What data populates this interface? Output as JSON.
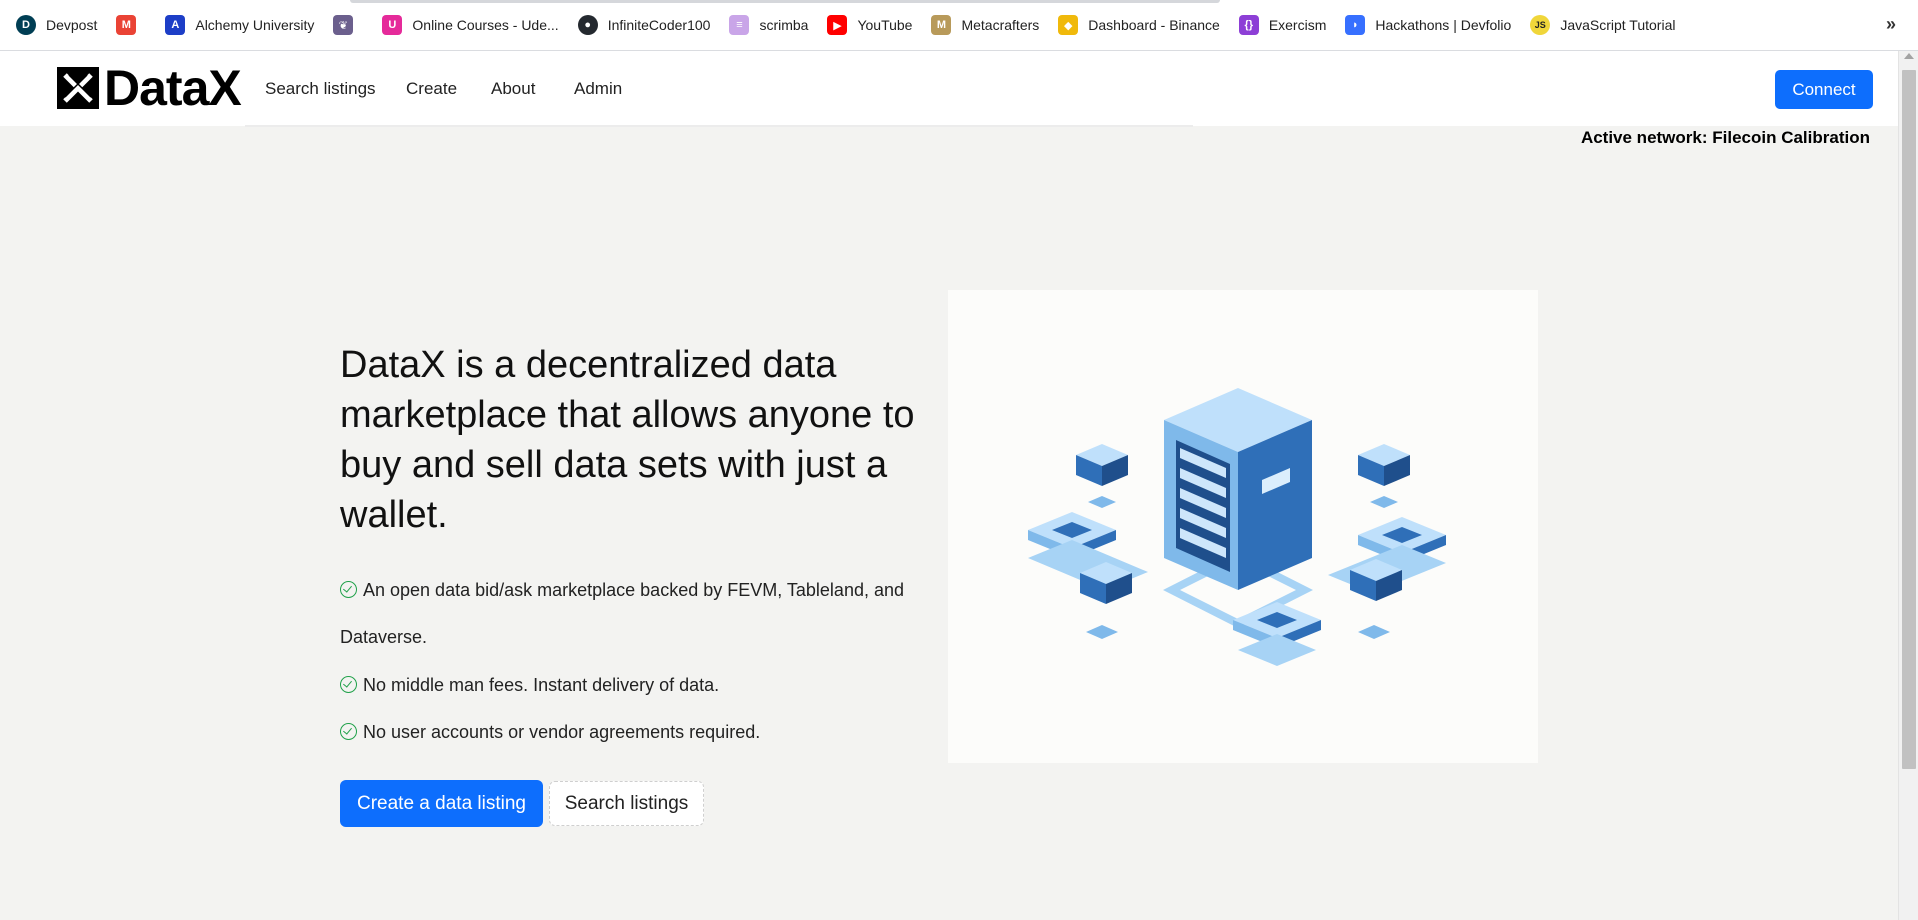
{
  "bookmarks": [
    {
      "label": "Devpost",
      "icon": "devpost-icon",
      "color": "#003e54",
      "glyph": "D"
    },
    {
      "label": "",
      "icon": "gmail-icon",
      "color": "#ea4335",
      "glyph": "M"
    },
    {
      "label": "Alchemy University",
      "icon": "alchemy-icon",
      "color": "#1d3ec7",
      "glyph": "A"
    },
    {
      "label": "",
      "icon": "bird-icon",
      "color": "#6b5f8d",
      "glyph": "❦"
    },
    {
      "label": "Online Courses - Ude...",
      "icon": "udemy-icon",
      "color": "#e52a9a",
      "glyph": "U"
    },
    {
      "label": "InfiniteCoder100",
      "icon": "github-icon",
      "color": "#24292f",
      "glyph": "●"
    },
    {
      "label": "scrimba",
      "icon": "scrimba-icon",
      "color": "#c9a5e8",
      "glyph": "≡"
    },
    {
      "label": "YouTube",
      "icon": "youtube-icon",
      "color": "#ff0000",
      "glyph": "▶"
    },
    {
      "label": "Metacrafters",
      "icon": "metacrafters-icon",
      "color": "#b89a5a",
      "glyph": "M"
    },
    {
      "label": "Dashboard - Binance",
      "icon": "binance-icon",
      "color": "#f0b90b",
      "glyph": "◆"
    },
    {
      "label": "Exercism",
      "icon": "exercism-icon",
      "color": "#8d3fd6",
      "glyph": "{}"
    },
    {
      "label": "Hackathons | Devfolio",
      "icon": "devfolio-icon",
      "color": "#3770ff",
      "glyph": "◗"
    },
    {
      "label": "JavaScript Tutorial",
      "icon": "javascript-icon",
      "color": "#f0d63a",
      "glyph": "JS"
    }
  ],
  "bookmarks_more": "»",
  "navbar": {
    "logo_text": "DataX",
    "links": [
      "Search listings",
      "Create",
      "About",
      "Admin"
    ],
    "connect_label": "Connect"
  },
  "active_network": "Active network: Filecoin Calibration",
  "hero": {
    "heading": "DataX is a decentralized data marketplace that allows anyone to buy and sell data sets with just a wallet.",
    "features": [
      "An open data bid/ask marketplace backed by FEVM, Tableland, and Dataverse.",
      "No middle man fees. Instant delivery of data.",
      "No user accounts or vendor agreements required."
    ],
    "primary_button": "Create a data listing",
    "secondary_button": "Search listings"
  },
  "colors": {
    "accent": "#0d6efd",
    "check": "#20a14a",
    "page_bg": "#f3f3f1"
  }
}
